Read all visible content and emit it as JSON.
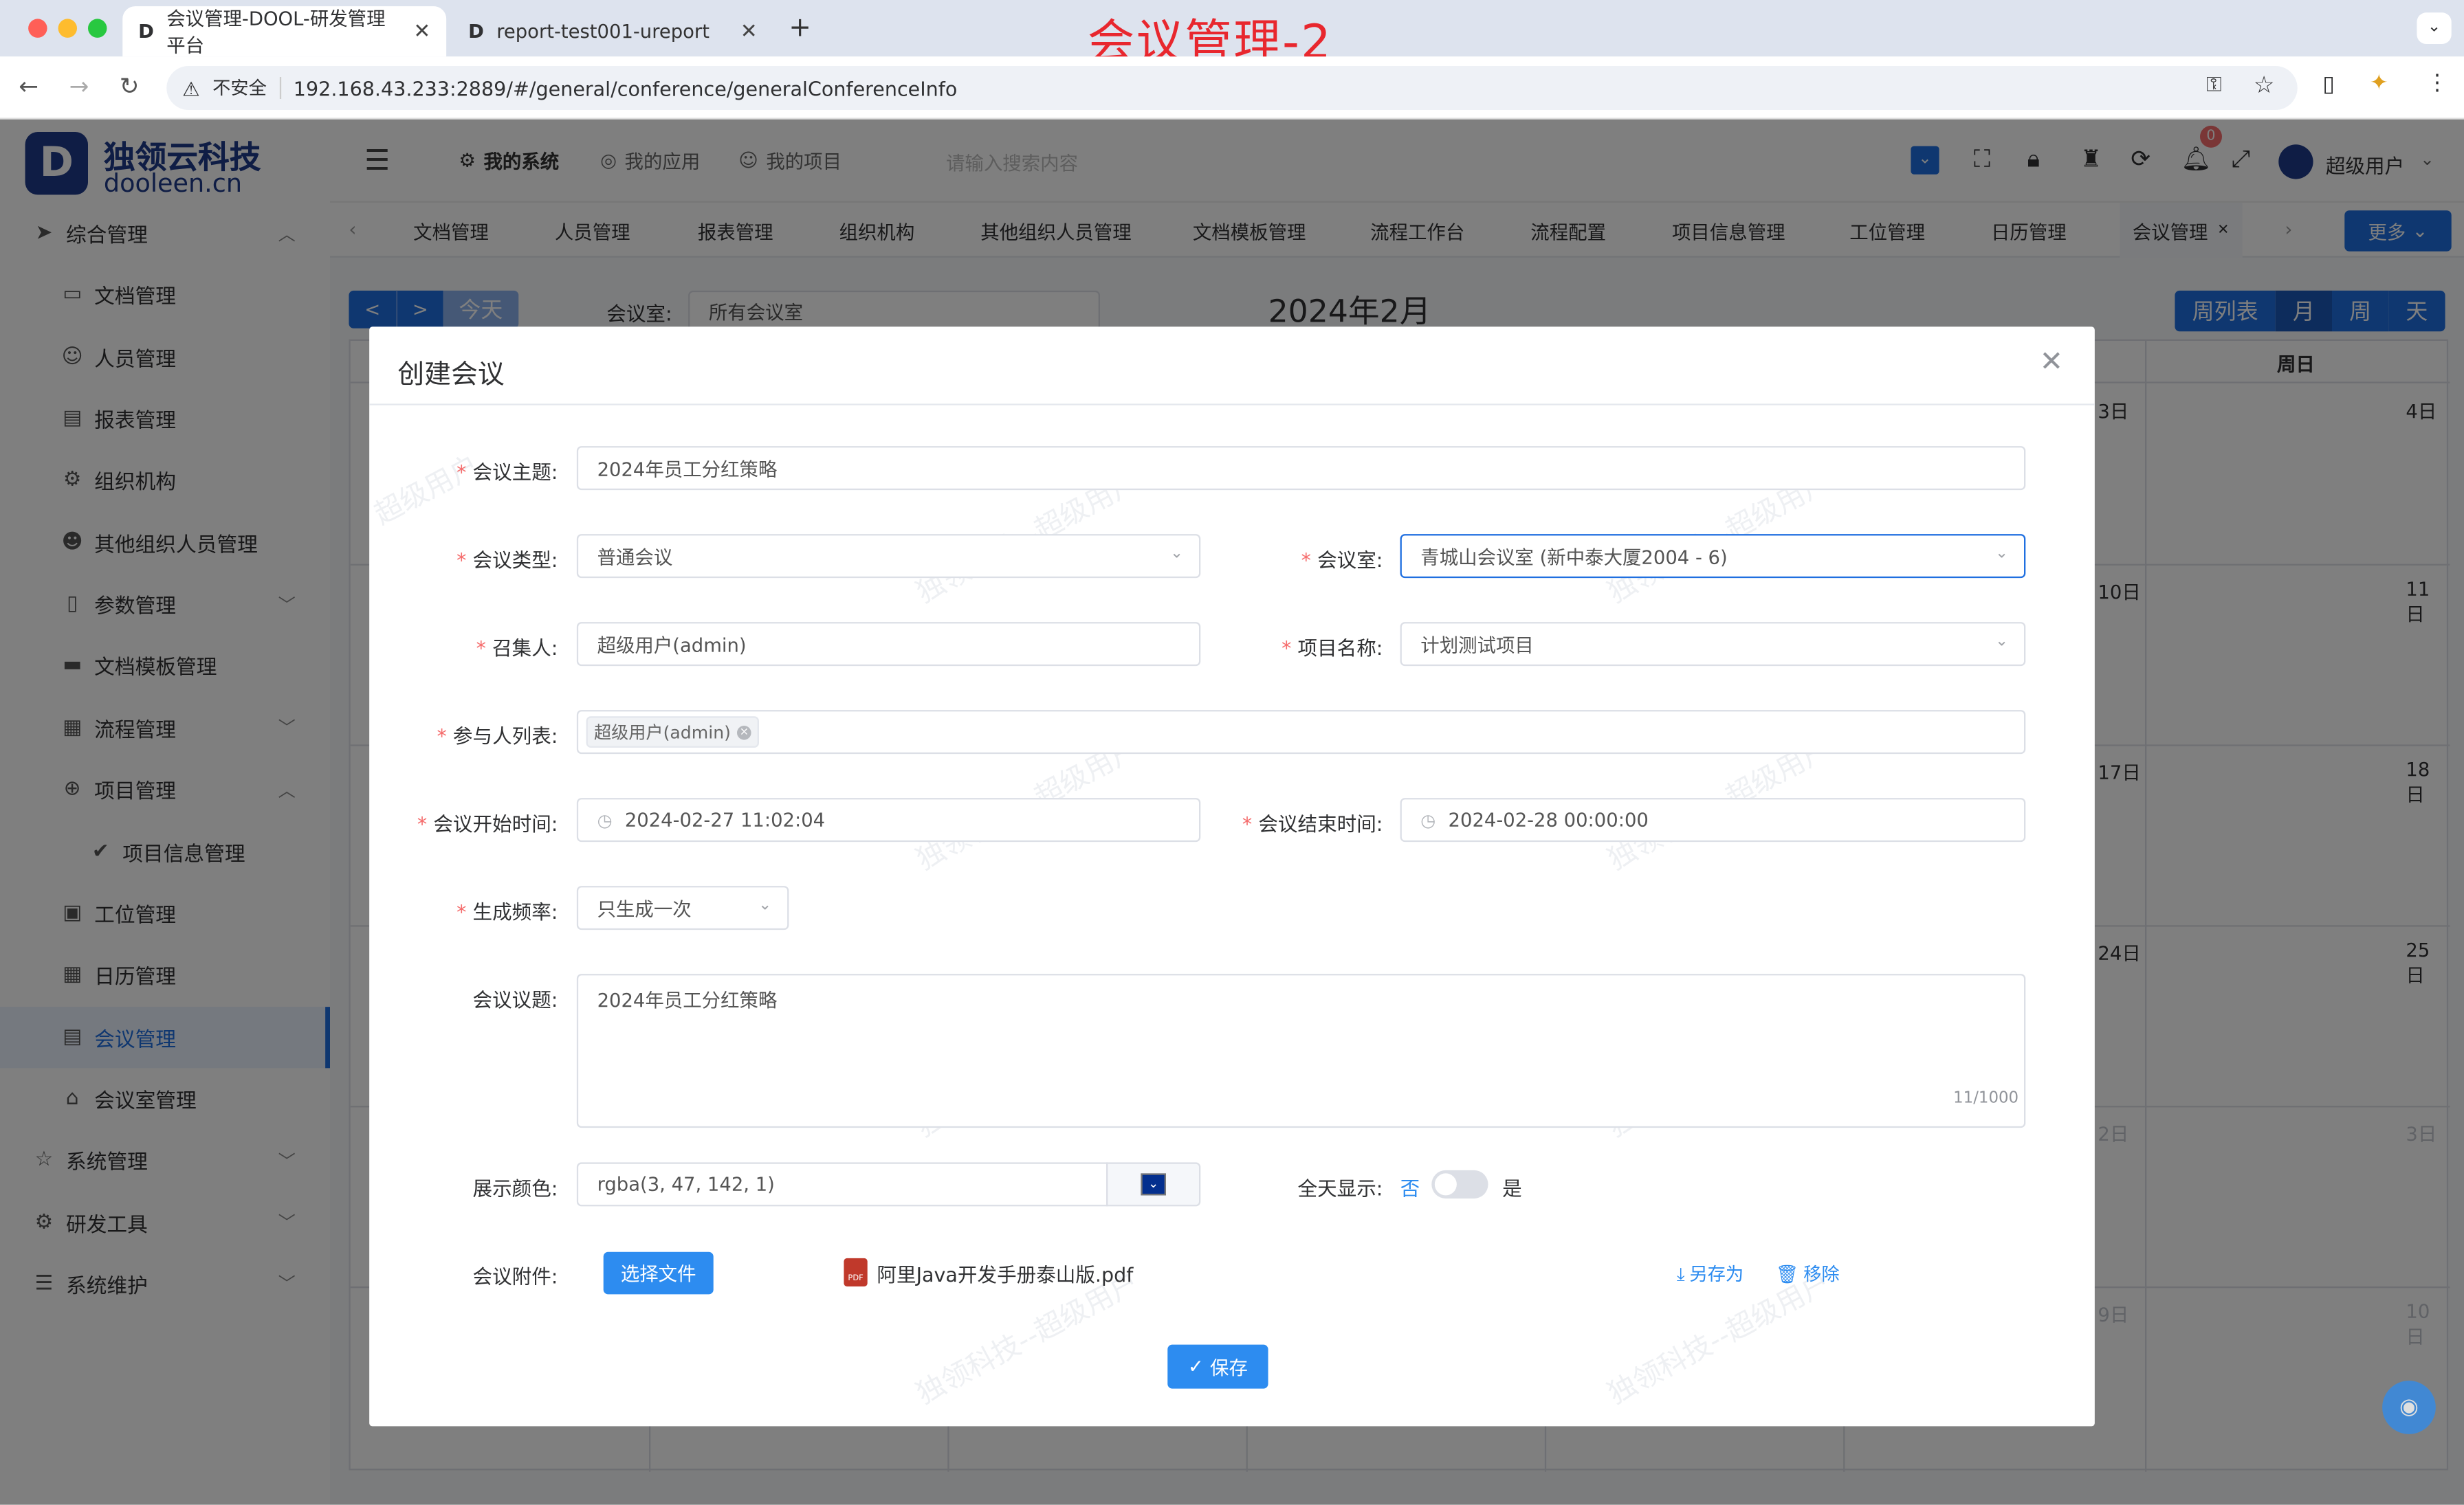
{
  "overlay_title": "会议管理-2",
  "browser": {
    "tabs": [
      {
        "title": "会议管理-DOOL-研发管理平台",
        "active": true
      },
      {
        "title": "report-test001-ureport",
        "active": false
      }
    ],
    "security_label": "不安全",
    "url": "192.168.43.233:2889/#/general/conference/generalConferenceInfo"
  },
  "brand": {
    "name_cn": "独领云科技",
    "name_en": "dooleen.cn"
  },
  "sidebar": {
    "items": [
      {
        "label": "综合管理",
        "icon": "send-icon",
        "level": 1,
        "arrow": "up"
      },
      {
        "label": "文档管理",
        "icon": "folder-icon",
        "level": 2
      },
      {
        "label": "人员管理",
        "icon": "user-icon",
        "level": 2
      },
      {
        "label": "报表管理",
        "icon": "report-icon",
        "level": 2
      },
      {
        "label": "组织机构",
        "icon": "gear-icon",
        "level": 2
      },
      {
        "label": "其他组织人员管理",
        "icon": "smile-icon",
        "level": 2
      },
      {
        "label": "参数管理",
        "icon": "param-icon",
        "level": 2,
        "arrow": "down"
      },
      {
        "label": "文档模板管理",
        "icon": "template-icon",
        "level": 2
      },
      {
        "label": "流程管理",
        "icon": "flow-icon",
        "level": 2,
        "arrow": "down"
      },
      {
        "label": "项目管理",
        "icon": "plus-circle-icon",
        "level": 2,
        "arrow": "up"
      },
      {
        "label": "项目信息管理",
        "icon": "check-circle-icon",
        "level": 3
      },
      {
        "label": "工位管理",
        "icon": "clipboard-icon",
        "level": 2
      },
      {
        "label": "日历管理",
        "icon": "calendar-icon",
        "level": 2
      },
      {
        "label": "会议管理",
        "icon": "doc-icon",
        "level": 2,
        "active": true
      },
      {
        "label": "会议室管理",
        "icon": "home-icon",
        "level": 2
      },
      {
        "label": "系统管理",
        "icon": "star-icon",
        "level": 1,
        "arrow": "down"
      },
      {
        "label": "研发工具",
        "icon": "cog-icon",
        "level": 1,
        "arrow": "down"
      },
      {
        "label": "系统维护",
        "icon": "sliders-icon",
        "level": 1,
        "arrow": "down"
      }
    ]
  },
  "header": {
    "tabs": [
      "我的系统",
      "我的应用",
      "我的项目"
    ],
    "search_placeholder": "请输入搜索内容",
    "notify_count": "0",
    "user_name": "超级用户"
  },
  "tags": [
    "文档管理",
    "人员管理",
    "报表管理",
    "组织机构",
    "其他组织人员管理",
    "文档模板管理",
    "流程工作台",
    "流程配置",
    "项目信息管理",
    "工位管理",
    "日历管理",
    "会议管理"
  ],
  "more_label": "更多",
  "calendar": {
    "prev": "<",
    "next": ">",
    "today": "今天",
    "room_label": "会议室:",
    "room_value": "所有会议室",
    "title": "2024年2月",
    "views": [
      "周列表",
      "月",
      "周",
      "天"
    ],
    "sunday": "周日",
    "day_labels": [
      "3日",
      "4日",
      "10日",
      "11日",
      "17日",
      "18日",
      "24日",
      "25日",
      "2日",
      "3日",
      "9日",
      "10日"
    ]
  },
  "dialog": {
    "title": "创建会议",
    "fields": {
      "subject_label": "会议主题:",
      "subject": "2024年员工分红策略",
      "type_label": "会议类型:",
      "type": "普通会议",
      "room_label": "会议室:",
      "room": "青城山会议室 (新中泰大厦2004 - 6)",
      "convener_label": "召集人:",
      "convener": "超级用户(admin)",
      "project_label": "项目名称:",
      "project": "计划测试项目",
      "participants_label": "参与人列表:",
      "participant": "超级用户(admin)",
      "start_label": "会议开始时间:",
      "start": "2024-02-27 11:02:04",
      "end_label": "会议结束时间:",
      "end": "2024-02-28 00:00:00",
      "freq_label": "生成频率:",
      "freq": "只生成一次",
      "topic_label": "会议议题:",
      "topic": "2024年员工分红策略",
      "topic_count": "11/1000",
      "color_label": "展示颜色:",
      "color": "rgba(3, 47, 142, 1)",
      "allday_label": "全天显示:",
      "allday_no": "否",
      "allday_yes": "是",
      "attach_label": "会议附件:",
      "choose_file": "选择文件",
      "file_name": "阿里Java开发手册泰山版.pdf",
      "save_as": "另存为",
      "remove": "移除"
    },
    "save": "保存",
    "watermark": "独领科技--超级用户"
  },
  "colors": {
    "primary": "#2d8cf0",
    "accent": "#1f6fe0",
    "required": "#f56c6c",
    "swatch": "#032f8e"
  }
}
